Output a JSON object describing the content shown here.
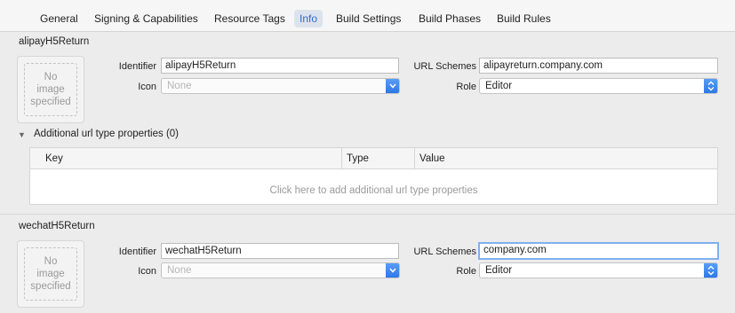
{
  "tabs": [
    {
      "label": "General"
    },
    {
      "label": "Signing & Capabilities"
    },
    {
      "label": "Resource Tags"
    },
    {
      "label": "Info",
      "active": true
    },
    {
      "label": "Build Settings"
    },
    {
      "label": "Build Phases"
    },
    {
      "label": "Build Rules"
    }
  ],
  "url_types": [
    {
      "title": "alipayH5Return",
      "image_placeholder": "No\nimage\nspecified",
      "identifier_label": "Identifier",
      "identifier_value": "alipayH5Return",
      "icon_label": "Icon",
      "icon_value": "None",
      "url_schemes_label": "URL Schemes",
      "url_schemes_value": "alipayreturn.company.com",
      "role_label": "Role",
      "role_value": "Editor"
    },
    {
      "title": "wechatH5Return",
      "image_placeholder": "No\nimage\nspecified",
      "identifier_label": "Identifier",
      "identifier_value": "wechatH5Return",
      "icon_label": "Icon",
      "icon_value": "None",
      "url_schemes_label": "URL Schemes",
      "url_schemes_value": "company.com",
      "role_label": "Role",
      "role_value": "Editor"
    }
  ],
  "additional": {
    "disclosure_label": "Additional url type properties (0)",
    "columns": [
      "Key",
      "Type",
      "Value"
    ],
    "empty_text": "Click here to add additional url type properties"
  },
  "colors": {
    "accent": "#2f6bd0",
    "popup_button": "#2a75e8",
    "focus_ring": "#7fb0f0"
  }
}
